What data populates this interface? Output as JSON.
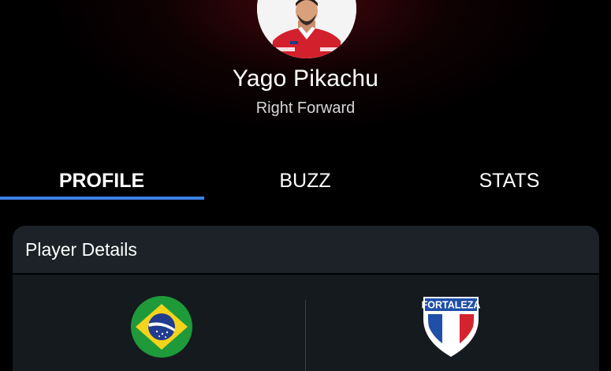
{
  "player": {
    "name": "Yago Pikachu",
    "position": "Right Forward"
  },
  "tabs": [
    {
      "label": "PROFILE",
      "active": true
    },
    {
      "label": "BUZZ",
      "active": false
    },
    {
      "label": "STATS",
      "active": false
    }
  ],
  "player_details": {
    "title": "Player Details",
    "nationality_icon": "brazil-flag-icon",
    "club_icon": "fortaleza-badge-icon",
    "club_badge_text": "FORTALEZA"
  },
  "colors": {
    "background": "#000000",
    "header_glow": "#780c16",
    "tab_indicator": "#3b82e6",
    "card_header": "#1c2227",
    "card_body": "#151a1e"
  }
}
